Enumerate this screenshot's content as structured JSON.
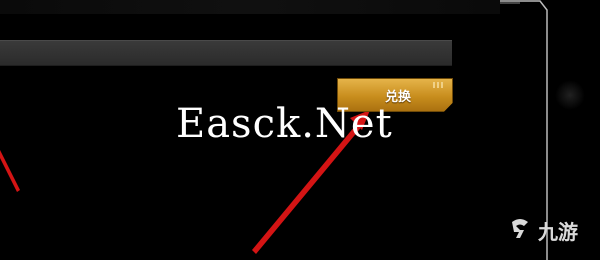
{
  "redeem_button": {
    "label": "兑换"
  },
  "watermark": {
    "text": "Easck.Net"
  },
  "brand_logo": {
    "text": "九游"
  },
  "colors": {
    "background": "#000000",
    "button_gold": "#c88d1d",
    "arrow_red": "#d41414",
    "frame_line": "#cfcfcf"
  }
}
